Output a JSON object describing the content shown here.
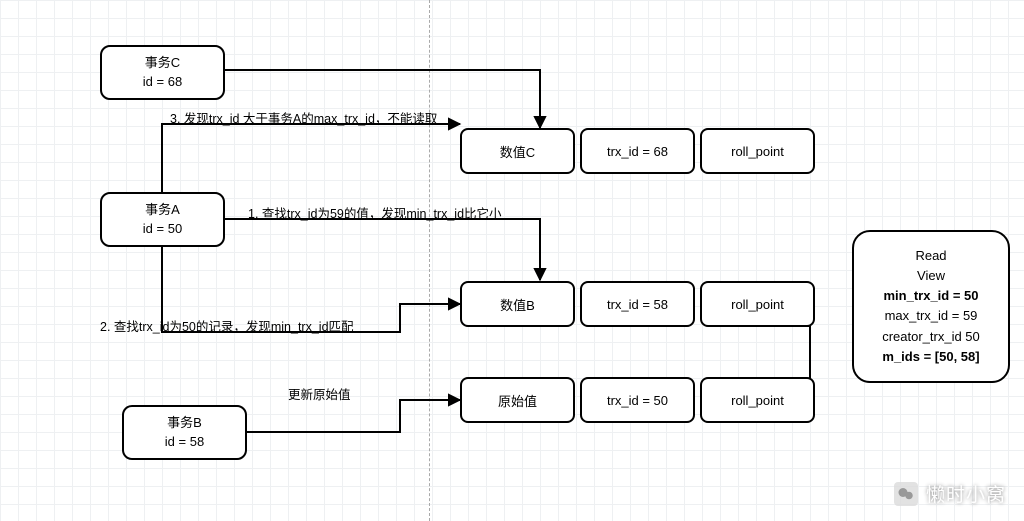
{
  "transactions": {
    "c": {
      "name": "事务C",
      "id_line": "id = 68"
    },
    "a": {
      "name": "事务A",
      "id_line": "id = 50"
    },
    "b": {
      "name": "事务B",
      "id_line": "id = 58"
    }
  },
  "rows": {
    "c": {
      "val": "数值C",
      "trx": "trx_id = 68",
      "roll": "roll_point"
    },
    "b": {
      "val": "数值B",
      "trx": "trx_id = 58",
      "roll": "roll_point"
    },
    "orig": {
      "val": "原始值",
      "trx": "trx_id = 50",
      "roll": "roll_point"
    }
  },
  "labels": {
    "step3": "3. 发现trx_id 大于事务A的max_trx_id，不能读取",
    "step1": "1. 查找trx_id为59的值，发现min_trx_id比它小",
    "step2": "2. 查找trx_id为50的记录，发现min_trx_id匹配",
    "update": "更新原始值"
  },
  "read_view": {
    "title1": "Read",
    "title2": "View",
    "min": "min_trx_id = 50",
    "max": "max_trx_id = 59",
    "creator": "creator_trx_id 50",
    "mids": "m_ids = [50, 58]"
  },
  "watermark": "懒时小窝"
}
